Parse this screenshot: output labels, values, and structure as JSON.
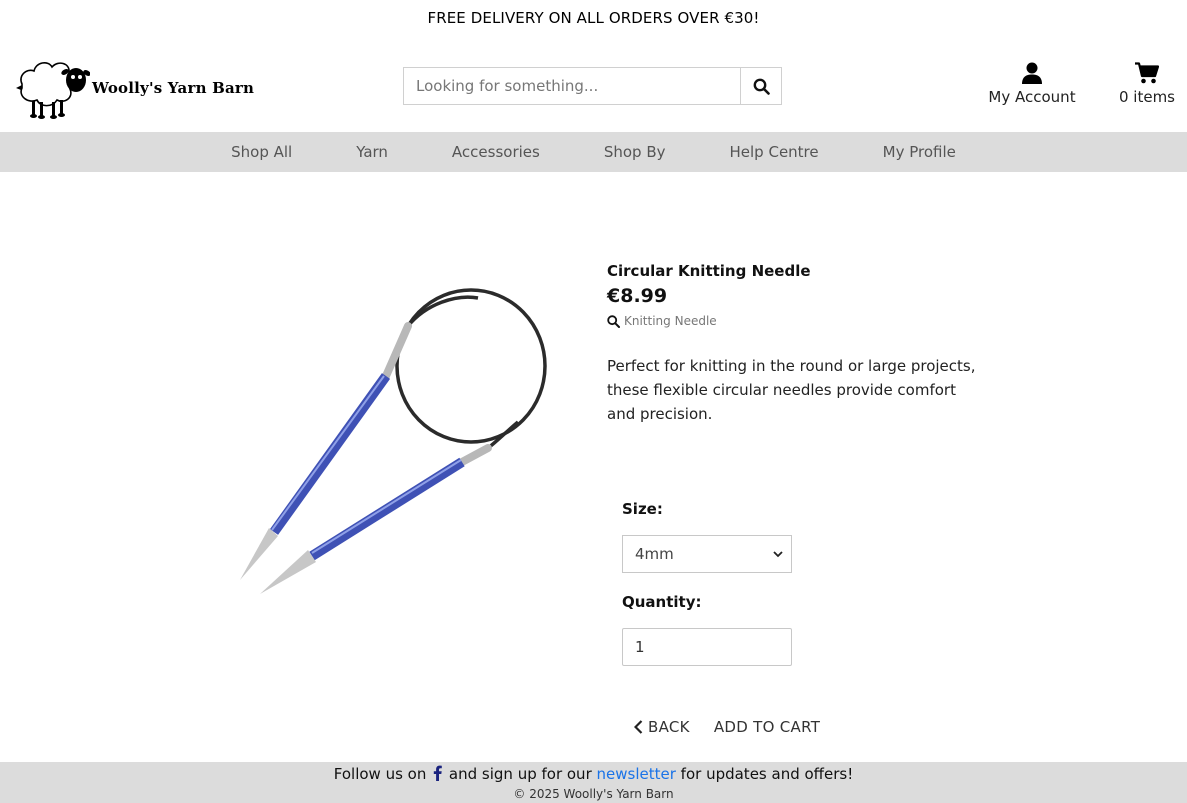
{
  "banner": {
    "text": "FREE DELIVERY ON ALL ORDERS OVER €30!"
  },
  "header": {
    "logo_text": "Woolly's Yarn Barn",
    "search_placeholder": "Looking for something...",
    "account_label": "My Account",
    "cart_label": "0 items"
  },
  "nav": {
    "items": [
      {
        "label": "Shop All"
      },
      {
        "label": "Yarn"
      },
      {
        "label": "Accessories"
      },
      {
        "label": "Shop By"
      },
      {
        "label": "Help Centre"
      },
      {
        "label": "My Profile"
      }
    ]
  },
  "product": {
    "title": "Circular Knitting Needle",
    "price": "€8.99",
    "category": "Knitting Needle",
    "description": "Perfect for knitting in the round or large projects, these flexible circular needles provide comfort and precision."
  },
  "form": {
    "size_label": "Size:",
    "size_value": "4mm",
    "quantity_label": "Quantity:",
    "quantity_value": "1"
  },
  "actions": {
    "back_label": "BACK",
    "add_label": "ADD TO CART"
  },
  "footer": {
    "text_before": "Follow us on",
    "text_middle": "and sign up for our",
    "newsletter_label": "newsletter",
    "text_after": "for updates and offers!",
    "copyright": "© 2025 Woolly's Yarn Barn"
  },
  "colors": {
    "nav_bg": "#dcdcdc",
    "link": "#1a73e8",
    "facebook": "#1a237e",
    "needle_blue": "#3f51b5"
  }
}
